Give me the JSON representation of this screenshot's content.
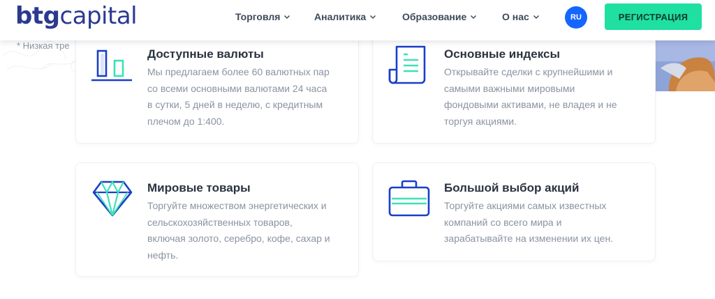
{
  "header": {
    "logo_bold": "btg",
    "logo_rest": "capital",
    "nav": [
      {
        "label": "Торговля"
      },
      {
        "label": "Аналитика"
      },
      {
        "label": "Образование"
      },
      {
        "label": "О нас"
      }
    ],
    "lang": "RU",
    "register_label": "РЕГИСТРАЦИЯ"
  },
  "note": "* Низкая тре",
  "cards": [
    {
      "icon": "bar-chart-icon",
      "title": "Доступные валюты",
      "lines": [
        "Мы предлагаем более 60 валютных пар",
        "со всеми основными валютами 24 часа",
        "в сутки, 5 дней в неделю, с кредитным",
        "плечом до 1:400."
      ]
    },
    {
      "icon": "document-scroll-icon",
      "title": "Основные индексы",
      "lines": [
        "Открывайте сделки с крупнейшими и",
        "самыми важными мировыми",
        "фондовыми активами, не владея и не",
        "торгуя акциями."
      ]
    },
    {
      "icon": "diamond-icon",
      "title": "Мировые товары",
      "lines": [
        "Торгуйте множеством энергетических и",
        "сельскохозяйственных товаров,",
        "включая золото, серебро, кофе, сахар и",
        "нефть."
      ]
    },
    {
      "icon": "briefcase-icon",
      "title": "Большой выбор акций",
      "lines": [
        "Торгуйте акциями самых известных",
        "компаний со всего мира и",
        "зарабатывайте на изменении их цен."
      ]
    }
  ],
  "colors": {
    "brand": "#2b3a8f",
    "accent": "#1fe0a0",
    "icon_blue": "#1a3fc7",
    "icon_mint": "#3ee0b8"
  }
}
